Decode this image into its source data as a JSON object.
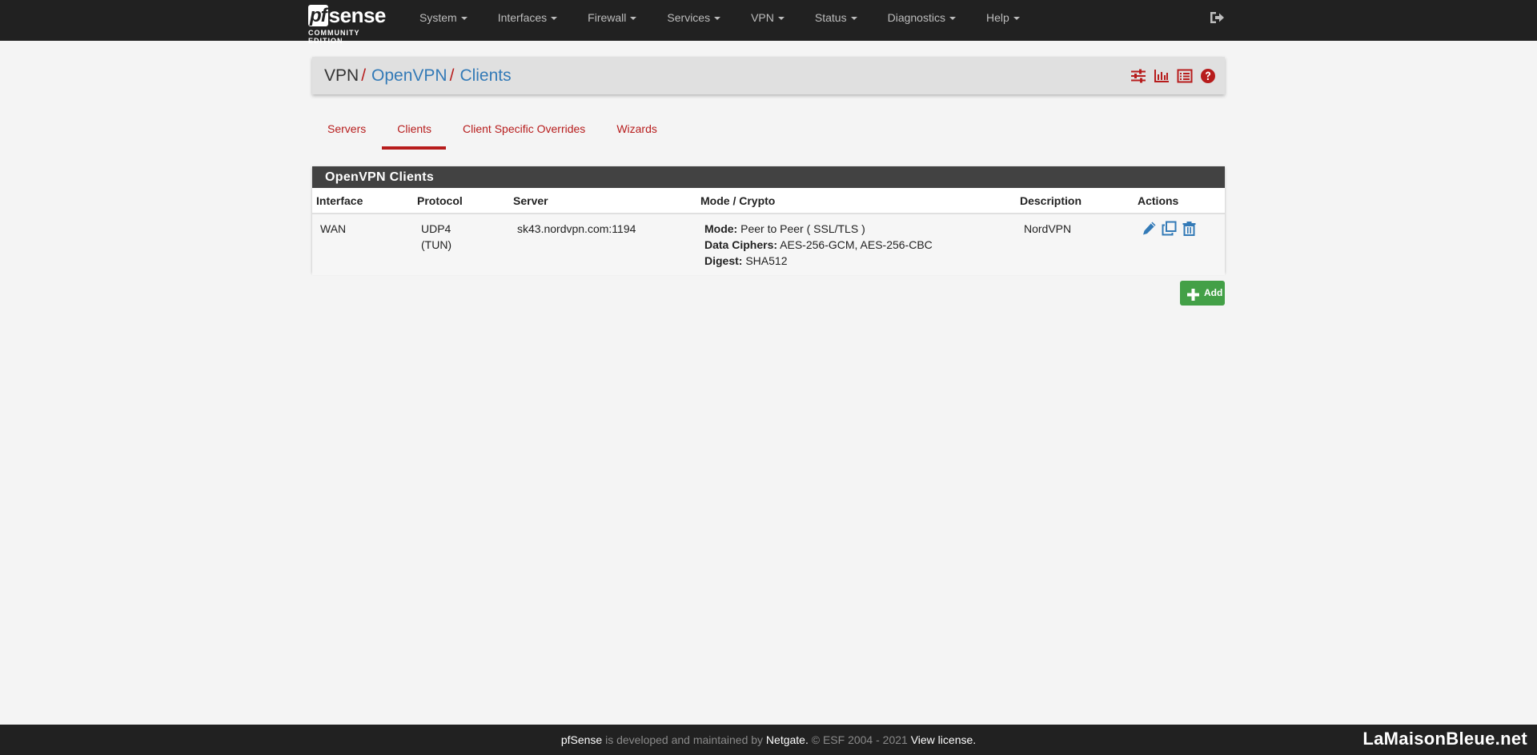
{
  "navbar": {
    "logo": {
      "main_pf": "pf",
      "main_sense": "sense",
      "sub": "COMMUNITY EDITION"
    },
    "menu": [
      {
        "label": "System"
      },
      {
        "label": "Interfaces"
      },
      {
        "label": "Firewall"
      },
      {
        "label": "Services"
      },
      {
        "label": "VPN"
      },
      {
        "label": "Status"
      },
      {
        "label": "Diagnostics"
      },
      {
        "label": "Help"
      }
    ],
    "logout_icon": "sign-out-icon"
  },
  "breadcrumb": {
    "root": "VPN",
    "separator": "/",
    "items": [
      "OpenVPN",
      "Clients"
    ],
    "icons": [
      "sliders-icon",
      "bar-chart-icon",
      "list-icon",
      "help-icon"
    ]
  },
  "tabs": [
    {
      "label": "Servers",
      "active": false
    },
    {
      "label": "Clients",
      "active": true
    },
    {
      "label": "Client Specific Overrides",
      "active": false
    },
    {
      "label": "Wizards",
      "active": false
    }
  ],
  "panel": {
    "title": "OpenVPN Clients",
    "columns": [
      "Interface",
      "Protocol",
      "Server",
      "Mode / Crypto",
      "Description",
      "Actions"
    ],
    "rows": [
      {
        "interface": "WAN",
        "protocol_line1": "UDP4",
        "protocol_line2": "(TUN)",
        "server": "sk43.nordvpn.com:1194",
        "mode_label": "Mode:",
        "mode_value": "Peer to Peer ( SSL/TLS )",
        "ciphers_label": "Data Ciphers:",
        "ciphers_value": "AES-256-GCM, AES-256-CBC",
        "digest_label": "Digest:",
        "digest_value": "SHA512",
        "description": "NordVPN",
        "actions": [
          "edit-icon",
          "copy-icon",
          "delete-icon"
        ]
      }
    ]
  },
  "add_button": {
    "label": "Add",
    "icon": "plus-icon"
  },
  "footer": {
    "brand": "pfSense",
    "text1": " is developed and maintained by ",
    "company": "Netgate.",
    "text2": " © ESF 2004 - 2021 ",
    "license": "View license.",
    "watermark": "LaMaisonBleue.net"
  },
  "colors": {
    "navbar": "#212121",
    "accent_red": "#b71c1c",
    "link_blue": "#337ab7",
    "panel_heading": "#424242",
    "add_green": "#43a047",
    "background": "#f4f4f4"
  }
}
